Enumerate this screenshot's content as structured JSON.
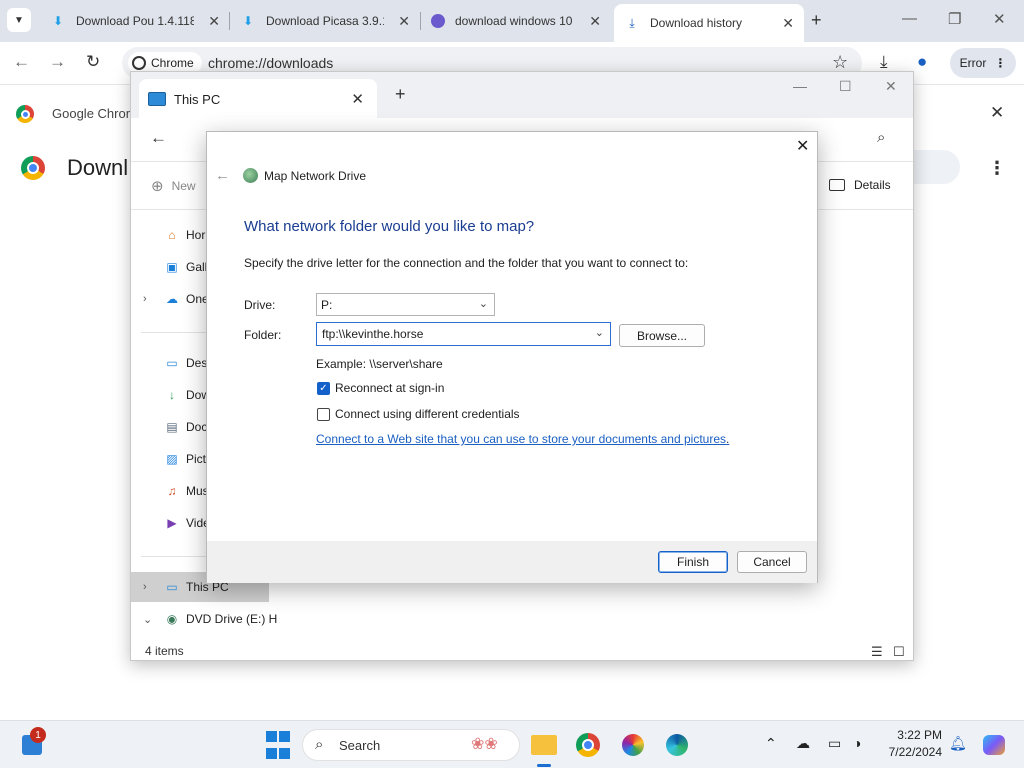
{
  "browser": {
    "tabs": [
      {
        "title": "Download Pou 1.4.118",
        "active": false
      },
      {
        "title": "Download Picasa 3.9.1",
        "active": false
      },
      {
        "title": "download windows 10",
        "active": false
      },
      {
        "title": "Download history",
        "active": true
      }
    ],
    "chip_label": "Chrome",
    "url": "chrome://downloads",
    "error_label": "Error",
    "banner_text": "Google Chrome",
    "page_title": "Downl"
  },
  "explorer": {
    "tab_title": "This PC",
    "new_label": "New",
    "details_label": "Details",
    "sidebar": [
      {
        "label": "Hor",
        "icon": "home-icon"
      },
      {
        "label": "Gall",
        "icon": "gallery-icon"
      },
      {
        "label": "One",
        "icon": "onedrive-icon"
      },
      {
        "label": "Desk",
        "icon": "desktop-icon"
      },
      {
        "label": "Dow",
        "icon": "downloads-icon"
      },
      {
        "label": "Doc",
        "icon": "documents-icon"
      },
      {
        "label": "Pict",
        "icon": "pictures-icon"
      },
      {
        "label": "Mus",
        "icon": "music-icon"
      },
      {
        "label": "Vide",
        "icon": "videos-icon"
      },
      {
        "label": "This PC",
        "icon": "monitor-icon"
      },
      {
        "label": "DVD Drive (E:) H",
        "icon": "dvd-drive-icon"
      }
    ],
    "status": "4 items"
  },
  "dialog": {
    "window_title": "Map Network Drive",
    "heading": "What network folder would you like to map?",
    "instructions": "Specify the drive letter for the connection and the folder that you want to connect to:",
    "drive_label": "Drive:",
    "drive_value": "P:",
    "folder_label": "Folder:",
    "folder_value": "ftp:\\\\kevinthe.horse",
    "browse_label": "Browse...",
    "example": "Example: \\\\server\\share",
    "reconnect_label": "Reconnect at sign-in",
    "reconnect_checked": true,
    "credentials_label": "Connect using different credentials",
    "credentials_checked": false,
    "link_text": "Connect to a Web site that you can use to store your documents and pictures",
    "link_suffix": ".",
    "finish_label": "Finish",
    "cancel_label": "Cancel"
  },
  "taskbar": {
    "notification_count": "1",
    "search_placeholder": "Search",
    "time": "3:22 PM",
    "date": "7/22/2024"
  }
}
